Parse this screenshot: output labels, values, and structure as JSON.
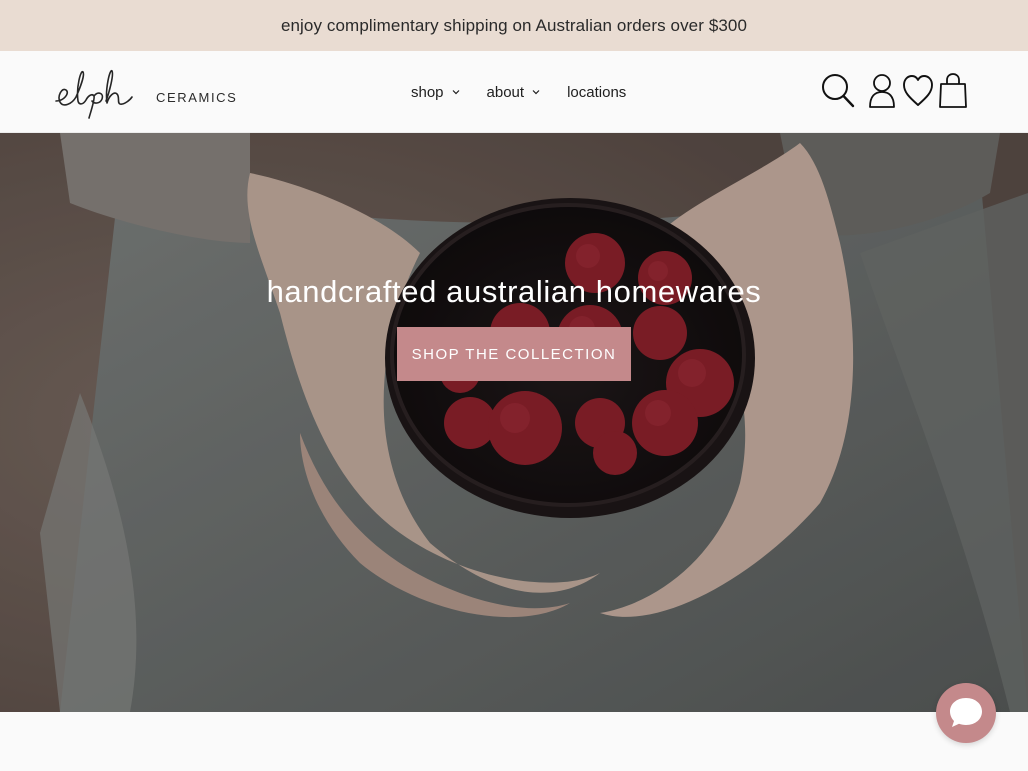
{
  "announcement": {
    "text": "enjoy complimentary shipping on Australian orders over $300"
  },
  "header": {
    "logo": {
      "script": "elph",
      "word": "CERAMICS"
    },
    "nav": [
      {
        "label": "shop",
        "has_dropdown": true
      },
      {
        "label": "about",
        "has_dropdown": true
      },
      {
        "label": "locations",
        "has_dropdown": false
      }
    ],
    "icons": [
      "search-icon",
      "account-icon",
      "wishlist-heart-icon",
      "cart-bag-icon"
    ]
  },
  "hero": {
    "title": "handcrafted australian homewares",
    "cta_label": "SHOP THE COLLECTION"
  },
  "chat": {
    "icon": "chat-bubble-icon"
  },
  "colors": {
    "announcement_bg": "#e9dcd2",
    "accent": "#c4898b",
    "header_bg": "#fafafa"
  }
}
